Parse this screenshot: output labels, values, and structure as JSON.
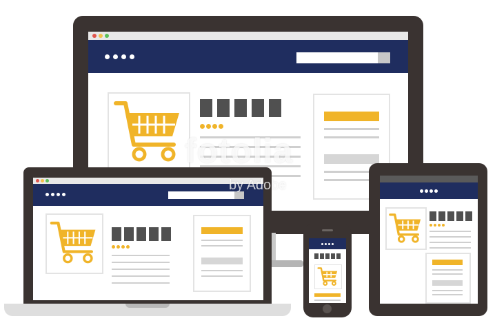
{
  "watermark": {
    "brand": "fotolia",
    "sub": "by Adobe"
  },
  "colors": {
    "frame": "#3a3331",
    "navbar": "#1f2d5f",
    "accent": "#f0b429",
    "squares": "#505050",
    "placeholder": "#d6d6d6"
  },
  "icons": {
    "cart": "shopping-cart-icon",
    "nav_dots": "ellipsis-dots-icon"
  }
}
